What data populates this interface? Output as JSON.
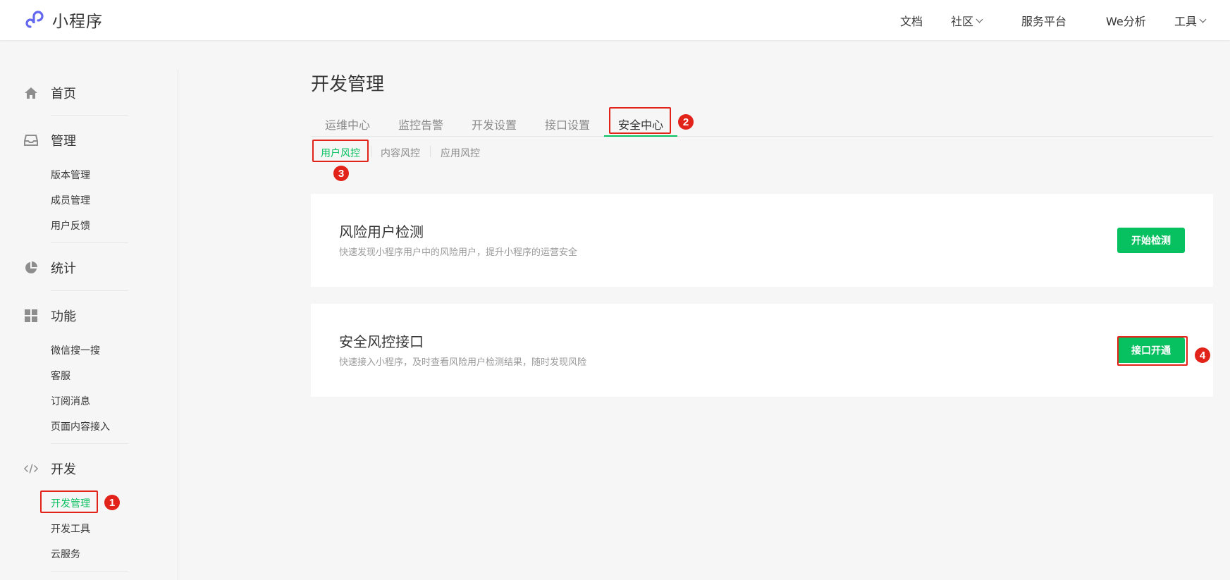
{
  "colors": {
    "accent": "#07c160",
    "annotation": "#e2231a",
    "text": "#353535",
    "muted": "#8a8a8a"
  },
  "app": {
    "title": "小程序",
    "logo_icon": "miniprogram-logo-icon"
  },
  "topnav": [
    {
      "label": "文档",
      "has_dropdown": false
    },
    {
      "label": "社区",
      "has_dropdown": true
    },
    {
      "label": "服务平台",
      "has_dropdown": false
    },
    {
      "label": "We分析",
      "has_dropdown": false
    },
    {
      "label": "工具",
      "has_dropdown": true
    }
  ],
  "sidebar": {
    "home": {
      "label": "首页",
      "icon": "home-icon"
    },
    "manage": {
      "label": "管理",
      "icon": "inbox-icon",
      "items": [
        "版本管理",
        "成员管理",
        "用户反馈"
      ]
    },
    "stats": {
      "label": "统计",
      "icon": "pie-chart-icon"
    },
    "features": {
      "label": "功能",
      "icon": "grid-icon",
      "items": [
        "微信搜一搜",
        "客服",
        "订阅消息",
        "页面内容接入"
      ]
    },
    "develop": {
      "label": "开发",
      "icon": "code-icon",
      "items": [
        "开发管理",
        "开发工具",
        "云服务"
      ],
      "active_item": "开发管理"
    }
  },
  "main": {
    "title": "开发管理",
    "tabs": [
      "运维中心",
      "监控告警",
      "开发设置",
      "接口设置",
      "安全中心"
    ],
    "active_tab": "安全中心",
    "subtabs": [
      "用户风控",
      "内容风控",
      "应用风控"
    ],
    "active_subtab": "用户风控",
    "cards": [
      {
        "title": "风险用户检测",
        "desc": "快速发现小程序用户中的风险用户，提升小程序的运营安全",
        "button": "开始检测"
      },
      {
        "title": "安全风控接口",
        "desc": "快速接入小程序，及时查看风险用户检测结果，随时发现风险",
        "button": "接口开通"
      }
    ]
  },
  "annotations": [
    "1",
    "2",
    "3",
    "4"
  ]
}
